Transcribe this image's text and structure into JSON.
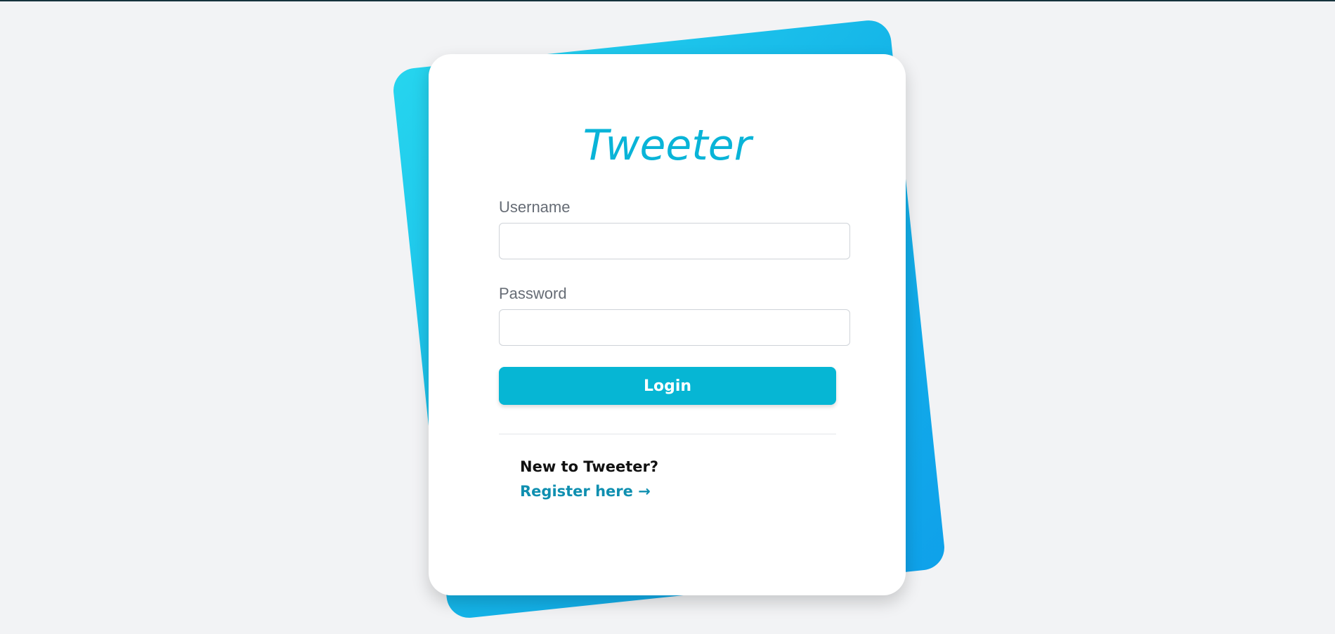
{
  "app": {
    "brand_title": "Tweeter"
  },
  "login_form": {
    "username_label": "Username",
    "username_value": "",
    "username_placeholder": "",
    "password_label": "Password",
    "password_value": "",
    "password_placeholder": "",
    "login_button_label": "Login"
  },
  "register": {
    "prompt": "New to Tweeter?",
    "link_label": "Register here →"
  },
  "colors": {
    "accent": "#06b6d4",
    "title": "#09b4d8",
    "link": "#0f8fb0",
    "background": "#f2f3f5",
    "panel_gradient_start": "#26d5ee",
    "panel_gradient_end": "#0fa1ea"
  }
}
